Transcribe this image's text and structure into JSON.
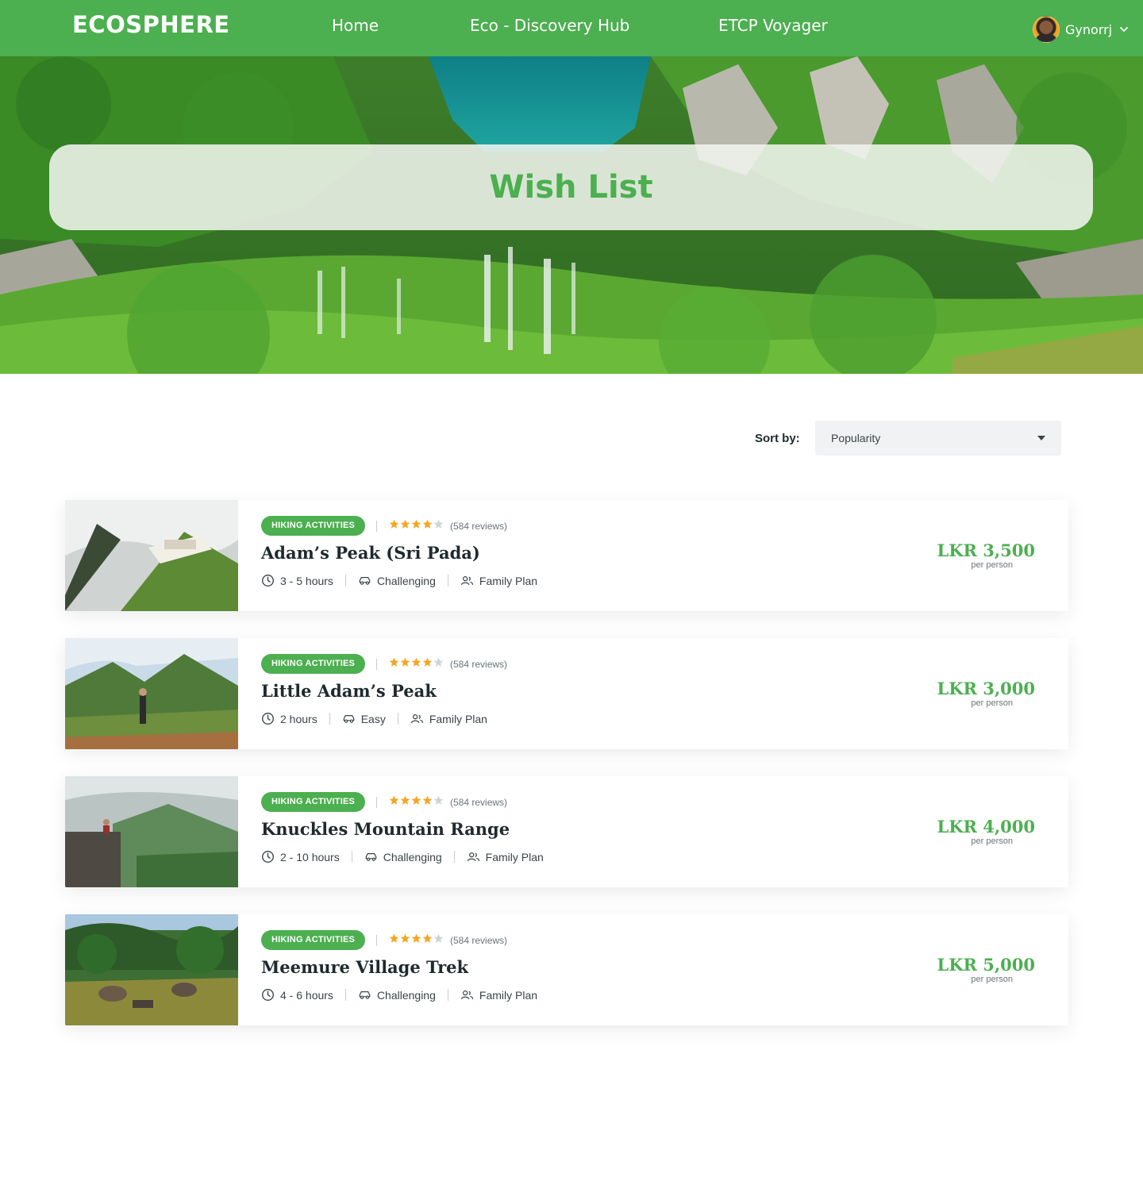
{
  "nav": {
    "logo": "ECOSPHERE",
    "links": [
      "Home",
      "Eco - Discovery Hub",
      "ETCP Voyager"
    ],
    "user_name": "Gynorrj"
  },
  "hero": {
    "title": "Wish List"
  },
  "sort": {
    "label": "Sort by:",
    "value": "Popularity"
  },
  "items": [
    {
      "badge": "HIKING ACTIVITIES",
      "rating": 4,
      "reviews": "(584 reviews)",
      "title": "Adam’s Peak (Sri Pada)",
      "duration": "3 - 5 hours",
      "difficulty": "Challenging",
      "plan": "Family Plan",
      "price": "LKR 3,500",
      "per": "per person"
    },
    {
      "badge": "HIKING ACTIVITIES",
      "rating": 4,
      "reviews": "(584 reviews)",
      "title": "Little Adam’s Peak",
      "duration": "2 hours",
      "difficulty": "Easy",
      "plan": "Family Plan",
      "price": "LKR 3,000",
      "per": "per person"
    },
    {
      "badge": "HIKING ACTIVITIES",
      "rating": 4,
      "reviews": "(584 reviews)",
      "title": "Knuckles Mountain Range",
      "duration": "2 - 10 hours",
      "difficulty": "Challenging",
      "plan": "Family Plan",
      "price": "LKR 4,000",
      "per": "per person"
    },
    {
      "badge": "HIKING ACTIVITIES",
      "rating": 4,
      "reviews": "(584 reviews)",
      "title": "Meemure Village Trek",
      "duration": "4 - 6 hours",
      "difficulty": "Challenging",
      "plan": "Family Plan",
      "price": "LKR 5,000",
      "per": "per person"
    }
  ],
  "colors": {
    "brand": "#4caf50",
    "star": "#f5a623",
    "star_empty": "#cfd4d6"
  }
}
